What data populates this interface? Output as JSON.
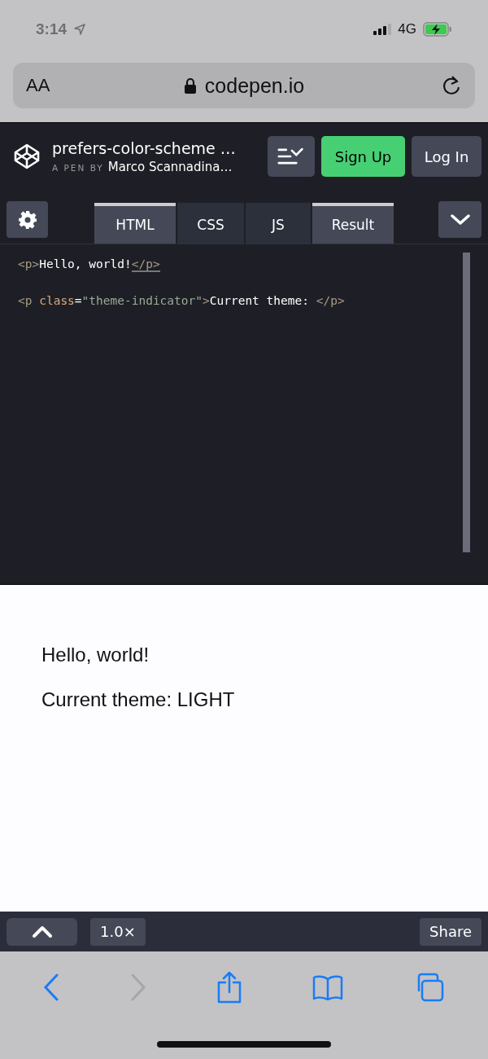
{
  "status_bar": {
    "time": "3:14",
    "network": "4G",
    "charging": true
  },
  "url_bar": {
    "text_size": "AA",
    "address": "codepen.io",
    "secure": true
  },
  "pen_header": {
    "title": "prefers-color-scheme …",
    "byline_prefix": "A PEN BY",
    "author": "Marco Scannadina…",
    "buttons": [
      {
        "label": "Sign Up",
        "kind": "primary"
      },
      {
        "label": "Log In",
        "kind": "secondary"
      }
    ]
  },
  "tabs": [
    {
      "label": "HTML",
      "selected": true
    },
    {
      "label": "CSS",
      "selected": false
    },
    {
      "label": "JS",
      "selected": false
    },
    {
      "label": "Result",
      "selected": true
    }
  ],
  "code_lines": [
    [
      {
        "kind": "tag",
        "text": "<p>"
      },
      {
        "kind": "text",
        "text": "Hello, world!"
      },
      {
        "kind": "tag",
        "text": "</p>",
        "matched": true
      }
    ],
    [
      {
        "kind": "tag",
        "text": "<p "
      },
      {
        "kind": "attr",
        "text": "class"
      },
      {
        "kind": "text",
        "text": "="
      },
      {
        "kind": "string",
        "text": "\"theme-indicator\""
      },
      {
        "kind": "tag",
        "text": ">"
      },
      {
        "kind": "text",
        "text": "Current theme: "
      },
      {
        "kind": "tag",
        "text": "</p>",
        "matched": false
      }
    ]
  ],
  "result": {
    "paragraphs": [
      "Hello, world!",
      "Current theme: LIGHT"
    ]
  },
  "pen_footer": {
    "zoom": "1.0×",
    "share": "Share"
  },
  "toolbar": {
    "back_enabled": true,
    "forward_enabled": false
  }
}
